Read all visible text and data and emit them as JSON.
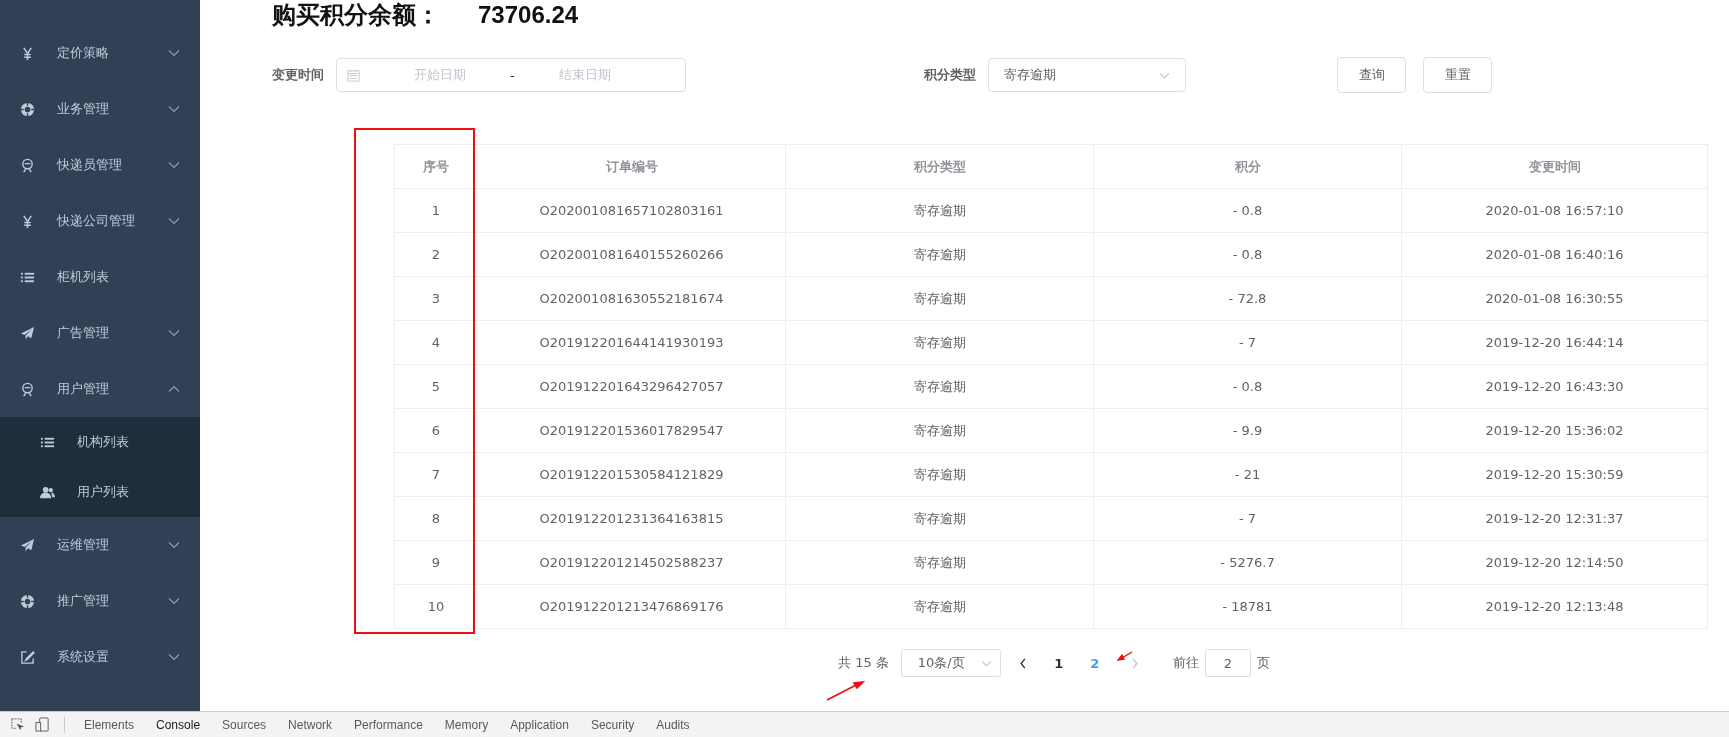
{
  "sidebar": {
    "items": [
      {
        "label": "定价策略",
        "kind": "submenu",
        "expanded": false
      },
      {
        "label": "业务管理",
        "kind": "submenu",
        "expanded": false
      },
      {
        "label": "快递员管理",
        "kind": "submenu",
        "expanded": false
      },
      {
        "label": "快递公司管理",
        "kind": "submenu",
        "expanded": false
      },
      {
        "label": "柜机列表",
        "kind": "link"
      },
      {
        "label": "广告管理",
        "kind": "submenu",
        "expanded": false
      },
      {
        "label": "用户管理",
        "kind": "submenu",
        "expanded": true,
        "children": [
          {
            "label": "机构列表"
          },
          {
            "label": "用户列表"
          }
        ]
      },
      {
        "label": "运维管理",
        "kind": "submenu",
        "expanded": false
      },
      {
        "label": "推广管理",
        "kind": "submenu",
        "expanded": false
      },
      {
        "label": "系统设置",
        "kind": "submenu",
        "expanded": false
      }
    ]
  },
  "balance": {
    "label": "购买积分余额：",
    "value": "73706.24"
  },
  "filters": {
    "date_label": "变更时间",
    "start_placeholder": "开始日期",
    "separator": "-",
    "end_placeholder": "结束日期",
    "type_label": "积分类型",
    "type_value": "寄存逾期",
    "buttons": [
      "查询",
      "重置"
    ]
  },
  "table": {
    "columns": [
      "序号",
      "订单编号",
      "积分类型",
      "积分",
      "变更时间"
    ],
    "rows": [
      [
        "1",
        "O202001081657102803161",
        "寄存逾期",
        "- 0.8",
        "2020-01-08 16:57:10"
      ],
      [
        "2",
        "O202001081640155260266",
        "寄存逾期",
        "- 0.8",
        "2020-01-08 16:40:16"
      ],
      [
        "3",
        "O202001081630552181674",
        "寄存逾期",
        "- 72.8",
        "2020-01-08 16:30:55"
      ],
      [
        "4",
        "O201912201644141930193",
        "寄存逾期",
        "- 7",
        "2019-12-20 16:44:14"
      ],
      [
        "5",
        "O201912201643296427057",
        "寄存逾期",
        "- 0.8",
        "2019-12-20 16:43:30"
      ],
      [
        "6",
        "O201912201536017829547",
        "寄存逾期",
        "- 9.9",
        "2019-12-20 15:36:02"
      ],
      [
        "7",
        "O201912201530584121829",
        "寄存逾期",
        "- 21",
        "2019-12-20 15:30:59"
      ],
      [
        "8",
        "O201912201231364163815",
        "寄存逾期",
        "- 7",
        "2019-12-20 12:31:37"
      ],
      [
        "9",
        "O201912201214502588237",
        "寄存逾期",
        "- 5276.7",
        "2019-12-20 12:14:50"
      ],
      [
        "10",
        "O201912201213476869176",
        "寄存逾期",
        "- 18781",
        "2019-12-20 12:13:48"
      ]
    ]
  },
  "pagination": {
    "total": "共 15 条",
    "page_size": "10条/页",
    "pages": [
      {
        "label": "1",
        "selected": false
      },
      {
        "label": "2",
        "selected": true
      }
    ],
    "goto_label": "前往",
    "goto_value": "2",
    "goto_suffix": "页"
  },
  "devtools": {
    "tabs": [
      {
        "label": "Elements",
        "selected": false
      },
      {
        "label": "Console",
        "selected": true
      },
      {
        "label": "Sources",
        "selected": false
      },
      {
        "label": "Network",
        "selected": false
      },
      {
        "label": "Performance",
        "selected": false
      },
      {
        "label": "Memory",
        "selected": false
      },
      {
        "label": "Application",
        "selected": false
      },
      {
        "label": "Security",
        "selected": false
      },
      {
        "label": "Audits",
        "selected": false
      }
    ]
  }
}
